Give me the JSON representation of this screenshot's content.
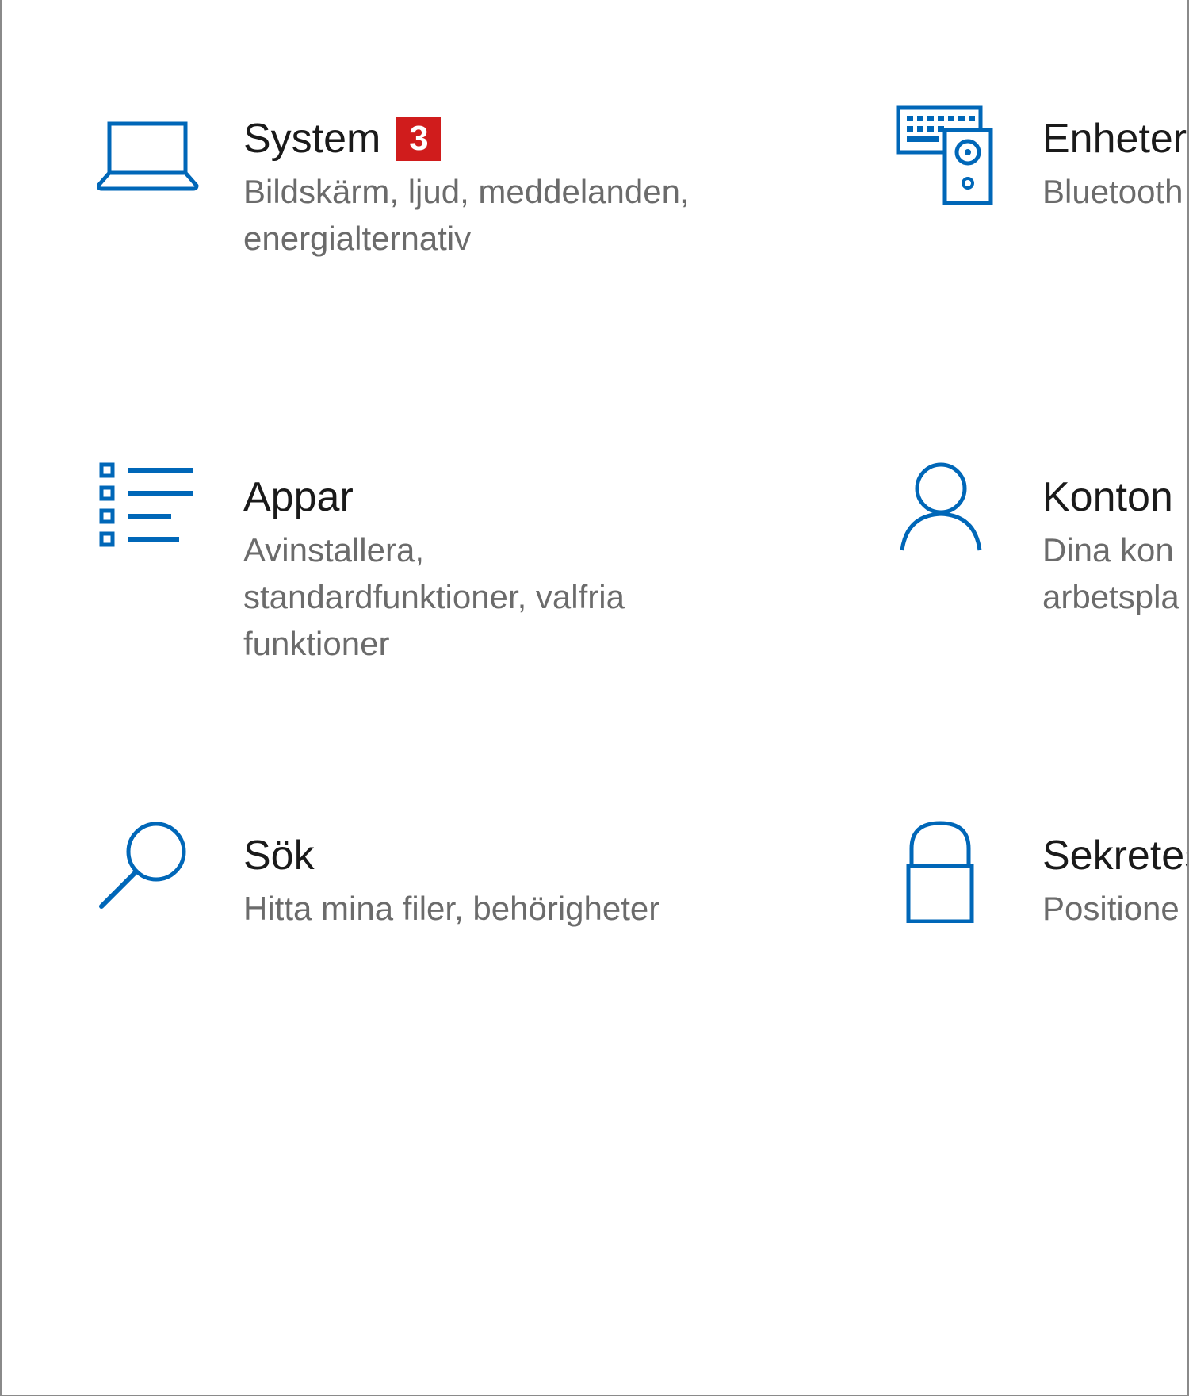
{
  "colors": {
    "accent": "#0067b8",
    "badge": "#d01c1c",
    "title_text": "#1a1a1a",
    "description_text": "#6b6b6b"
  },
  "tiles": [
    {
      "title": "System",
      "badge": "3",
      "description": "Bildskärm, ljud, meddelanden, energialternativ",
      "icon": "laptop-icon"
    },
    {
      "title": "Enheter",
      "description": "Bluetooth",
      "icon": "devices-icon"
    },
    {
      "title": "Appar",
      "description": "Avinstallera, standardfunktioner, valfria funktioner",
      "icon": "apps-list-icon"
    },
    {
      "title": "Konton",
      "description": "Dina kon arbetspla",
      "icon": "person-icon"
    },
    {
      "title": "Sök",
      "description": "Hitta mina filer, behörigheter",
      "icon": "search-icon"
    },
    {
      "title": "Sekretess",
      "description": "Positione",
      "icon": "lock-icon"
    }
  ]
}
